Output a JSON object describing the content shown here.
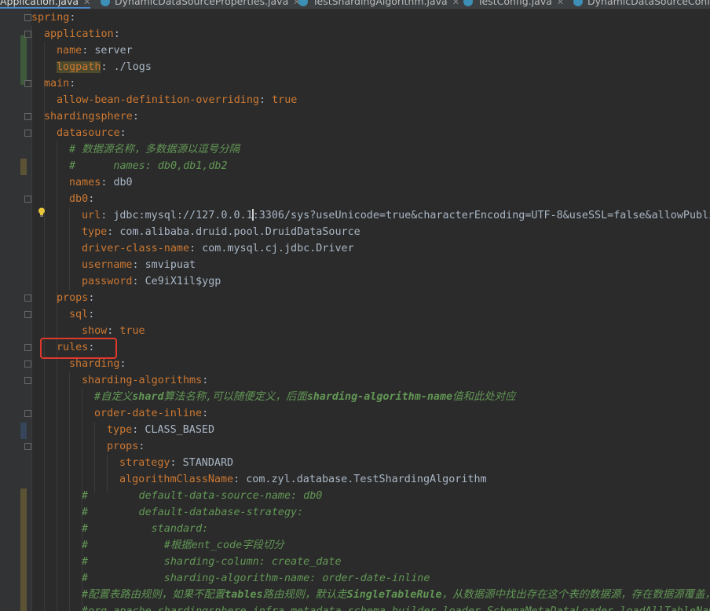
{
  "tabs": [
    {
      "label": "Application.java",
      "active": true
    },
    {
      "label": "DynamicDataSourceProperties.java",
      "active": false
    },
    {
      "label": "TestShardingAlgorithm.java",
      "active": false
    },
    {
      "label": "TestConfig.java",
      "active": false
    },
    {
      "label": "DynamicDataSourceConfig",
      "active": false
    }
  ],
  "code": {
    "l1": {
      "key": "spring"
    },
    "l2": {
      "key": "application"
    },
    "l3": {
      "key": "name",
      "value": "server"
    },
    "l4": {
      "key": "logpath",
      "value": "./logs"
    },
    "l5": {
      "key": "main"
    },
    "l6": {
      "key": "allow-bean-definition-overriding",
      "value": "true"
    },
    "l7": {
      "key": "shardingsphere"
    },
    "l8": {
      "key": "datasource"
    },
    "l9": {
      "comment": "# 数据源名称，多数据源以逗号分隔"
    },
    "l10": {
      "comment": "#      names: db0,db1,db2"
    },
    "l11": {
      "key": "names",
      "value": "db0"
    },
    "l12": {
      "key": "db0"
    },
    "l13": {
      "key": "url",
      "value_before_caret": "jdbc:mysql://127.0.0.1",
      "value_after_caret": ":3306/sys?useUnicode=true&characterEncoding=UTF-8&useSSL=false&allowPubli"
    },
    "l14": {
      "key": "type",
      "value": "com.alibaba.druid.pool.DruidDataSource"
    },
    "l15": {
      "key": "driver-class-name",
      "value": "com.mysql.cj.jdbc.Driver"
    },
    "l16": {
      "key": "username",
      "value": "smvipuat"
    },
    "l17": {
      "key": "password",
      "value": "Ce9iX1il$ygp"
    },
    "l18": {
      "key": "props"
    },
    "l19": {
      "key": "sql"
    },
    "l20": {
      "key": "show",
      "value": "true"
    },
    "l21": {
      "key": "rules"
    },
    "l22": {
      "key": "sharding"
    },
    "l23": {
      "key": "sharding-algorithms"
    },
    "l24": {
      "comment_a": "#自定义",
      "comment_b": "shard",
      "comment_c": "算法名称,可以随便定义，后面",
      "comment_d": "sharding-algorithm-name",
      "comment_e": "值和此处对应"
    },
    "l25": {
      "key": "order-date-inline"
    },
    "l26": {
      "key": "type",
      "value": "CLASS_BASED"
    },
    "l27": {
      "key": "props"
    },
    "l28": {
      "key": "strategy",
      "value": "STANDARD"
    },
    "l29": {
      "key": "algorithmClassName",
      "value": "com.zyl.database.TestShardingAlgorithm"
    },
    "l30": {
      "comment": "#        default-data-source-name: db0"
    },
    "l31": {
      "comment": "#        default-database-strategy:"
    },
    "l32": {
      "comment": "#          standard:"
    },
    "l33": {
      "comment": "#            #根据ent_code字段切分"
    },
    "l34": {
      "comment": "#            sharding-column: create_date"
    },
    "l35": {
      "comment": "#            sharding-algorithm-name: order-date-inline"
    },
    "l36": {
      "comment_a": "#配置表路由规则，如果不配置",
      "comment_b": "tables",
      "comment_c": "路由规则，默认走",
      "comment_d": "SingleTableRule",
      "comment_e": "，从数据源中找出存在这个表的数据源，存在数据源覆盖，参"
    },
    "l37": {
      "comment": "#org.apache.shardingsphere.infra.metadata.schema.builder.loader.SchemaMetaDataLoader.loadAllTableNames"
    }
  },
  "colors": {
    "key": "#cc7832",
    "value": "#a9b7c6",
    "comment": "#629755",
    "background": "#2b2b2b",
    "gutter": "#313335",
    "annotation_box": "#e0382c"
  },
  "icons": [
    "lightbulb-icon",
    "java-class-icon",
    "fold-marker-icon"
  ]
}
